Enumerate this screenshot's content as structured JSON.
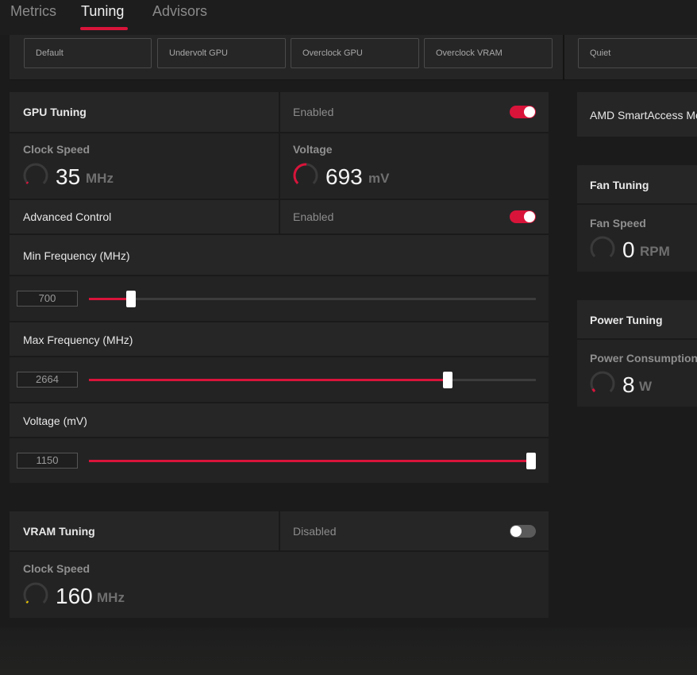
{
  "tabs": [
    {
      "label": "Metrics",
      "active": false
    },
    {
      "label": "Tuning",
      "active": true
    },
    {
      "label": "Advisors",
      "active": false
    }
  ],
  "presets": [
    "Default",
    "Undervolt GPU",
    "Overclock GPU",
    "Overclock VRAM",
    "Quiet"
  ],
  "gpu_tuning": {
    "title": "GPU Tuning",
    "status": "Enabled",
    "enabled": true,
    "clock_speed": {
      "label": "Clock Speed",
      "value": "35",
      "unit": "MHz"
    },
    "voltage": {
      "label": "Voltage",
      "value": "693",
      "unit": "mV"
    },
    "advanced_control": {
      "label": "Advanced Control",
      "status": "Enabled",
      "enabled": true
    },
    "min_frequency": {
      "label": "Min Frequency (MHz)",
      "value": "700",
      "fraction": 0.085
    },
    "max_frequency": {
      "label": "Max Frequency (MHz)",
      "value": "2664",
      "fraction": 0.81
    },
    "voltage_mv": {
      "label": "Voltage (mV)",
      "value": "1150",
      "fraction": 1.0
    }
  },
  "vram_tuning": {
    "title": "VRAM Tuning",
    "status": "Disabled",
    "enabled": false,
    "clock_speed": {
      "label": "Clock Speed",
      "value": "160",
      "unit": "MHz"
    }
  },
  "smart_access": {
    "label": "AMD SmartAccess Me"
  },
  "fan_tuning": {
    "title": "Fan Tuning",
    "fan_speed": {
      "label": "Fan Speed",
      "value": "0",
      "unit": "RPM"
    }
  },
  "power_tuning": {
    "title": "Power Tuning",
    "power": {
      "label": "Power Consumption",
      "value": "8",
      "unit": "W"
    }
  },
  "colors": {
    "accent": "#d8143a",
    "gauge_track": "#3a3a3b",
    "vram_gauge": "#e8c400"
  }
}
